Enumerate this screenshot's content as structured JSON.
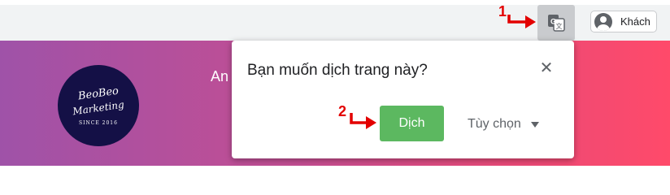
{
  "toolbar": {
    "translate_icon": "google-translate-icon",
    "profile": {
      "icon": "person-icon",
      "label": "Khách"
    }
  },
  "banner": {
    "logo": {
      "line1": "BeoBeo",
      "line2": "Marketing",
      "line3": "SINCE 2016"
    },
    "text": "An"
  },
  "translate_popup": {
    "title": "Bạn muốn dịch trang này?",
    "close_icon": "close-icon",
    "translate_label": "Dịch",
    "options_label": "Tùy chọn",
    "translate_color": "#5cb860"
  },
  "annotations": {
    "step1": "1",
    "step2": "2",
    "color": "#e30000"
  }
}
